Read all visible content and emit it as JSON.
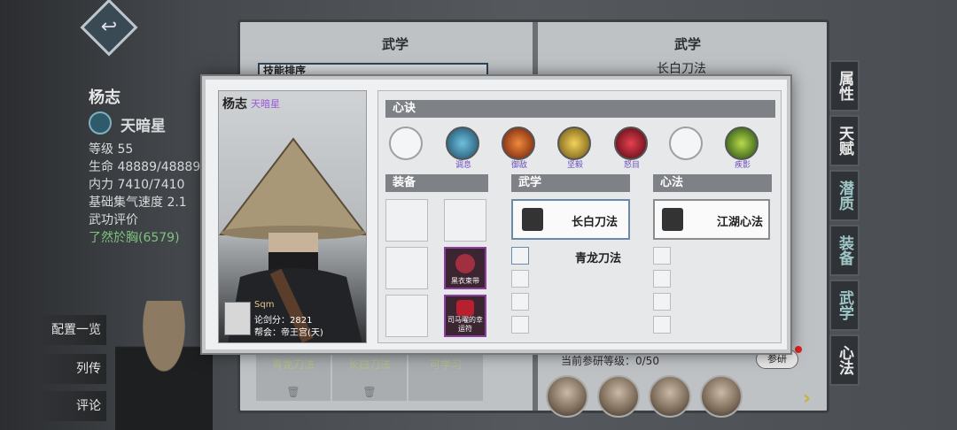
{
  "background": {
    "character_name": "杨志",
    "star_name": "天暗星",
    "stats": [
      "等级 55",
      "生命 48889/48889",
      "内力 7410/7410",
      "基础集气速度 2.1",
      "武功评价",
      "了然於胸(6579)"
    ],
    "left_menu": [
      "配置一览",
      "列传",
      "评论"
    ]
  },
  "book": {
    "left_title": "武学",
    "left_subtitle": "技能排序",
    "right_title": "武学",
    "right_subtitle": "长白刀法",
    "bottom_tabs": [
      "青龙刀法",
      "长白刀法",
      "可学习"
    ],
    "research_label": "当前参研等级：0/50",
    "research_button": "参研"
  },
  "side_tabs": [
    "属性",
    "天赋",
    "潜质",
    "装备",
    "武学",
    "心法"
  ],
  "modal": {
    "name": "杨志",
    "star": "天暗星",
    "player": {
      "username": "Sqm",
      "score": "论剑分：2821",
      "guild": "帮会：帝王宫(天)"
    },
    "xinjue_header": "心诀",
    "xinjue": [
      {
        "label": "",
        "icon": "empty-slot-icon",
        "color": ""
      },
      {
        "label": "调息",
        "icon": "blue-swirl-icon",
        "color": "#2a6f8f"
      },
      {
        "label": "御敌",
        "icon": "fire-figure-icon",
        "color": "#b3441c"
      },
      {
        "label": "坚毅",
        "icon": "gold-shield-icon",
        "color": "#c9a227"
      },
      {
        "label": "怒目",
        "icon": "red-eye-icon",
        "color": "#b01a28"
      },
      {
        "label": "",
        "icon": "empty-slot-icon",
        "color": ""
      },
      {
        "label": "疾影",
        "icon": "green-dragon-icon",
        "color": "#3f7a2a"
      }
    ],
    "equip_header": "装备",
    "equip_items": [
      "黑衣束带",
      "司马曜的幸运符"
    ],
    "wuxue_header": "武学",
    "wuxue_main": "长白刀法",
    "wuxue_second": "青龙刀法",
    "xinfa_header": "心法",
    "xinfa_main": "江湖心法"
  },
  "accent_color": "#6b4ec0"
}
